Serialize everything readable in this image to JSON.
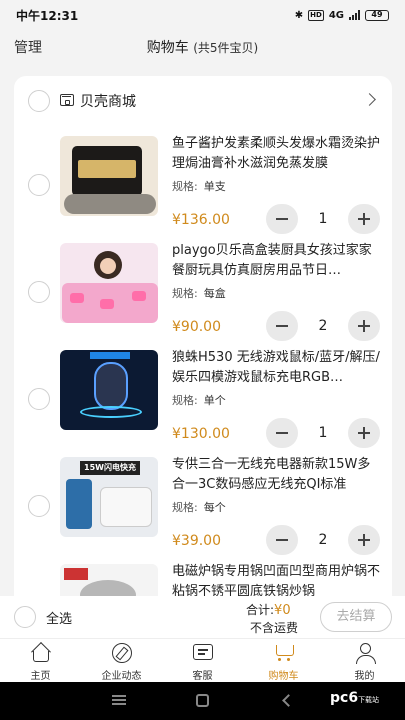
{
  "status_bar": {
    "time": "中午12:31",
    "network": "4G",
    "battery": "49"
  },
  "header": {
    "manage": "管理",
    "title": "购物车",
    "count": "(共5件宝贝)"
  },
  "shop": {
    "name": "贝壳商城"
  },
  "items": [
    {
      "name": "鱼子酱护发素柔顺头发爆水霜烫染护理焗油膏补水滋润免蒸发膜",
      "spec_label": "规格:",
      "spec": "单支",
      "price": "¥136.00",
      "qty": "1"
    },
    {
      "name": "playgo贝乐高盒装厨具女孩过家家餐厨玩具仿真厨房用品节日…",
      "spec_label": "规格:",
      "spec": "每盒",
      "price": "¥90.00",
      "qty": "2"
    },
    {
      "name": "狼蛛H530 无线游戏鼠标/蓝牙/解压/娱乐四模游戏鼠标充电RGB…",
      "spec_label": "规格:",
      "spec": "单个",
      "price": "¥130.00",
      "qty": "1"
    },
    {
      "name": "专供三合一无线充电器新款15W多合一3C数码感应无线充QI标准",
      "spec_label": "规格:",
      "spec": "每个",
      "price": "¥39.00",
      "qty": "2",
      "thumb_tag": "15W闪电快充"
    },
    {
      "name": "电磁炉锅专用锅凹面凹型商用炉锅不粘锅不锈平圆底铁锅炒锅",
      "spec_label": "",
      "spec": "",
      "price": "",
      "qty": ""
    }
  ],
  "footer": {
    "select_all": "全选",
    "total_label": "合计:",
    "total_amount": "¥0",
    "shipping": "不含运费",
    "checkout": "去结算"
  },
  "tabs": [
    {
      "label": "主页",
      "icon": "home-icon"
    },
    {
      "label": "企业动态",
      "icon": "compass-icon"
    },
    {
      "label": "客服",
      "icon": "chat-icon"
    },
    {
      "label": "购物车",
      "icon": "cart-icon",
      "active": true
    },
    {
      "label": "我的",
      "icon": "user-icon"
    }
  ],
  "watermark": {
    "text": "pc6",
    "sub": "下载站"
  },
  "colors": {
    "accent": "#d08a1c",
    "background": "#f3f3f3"
  }
}
